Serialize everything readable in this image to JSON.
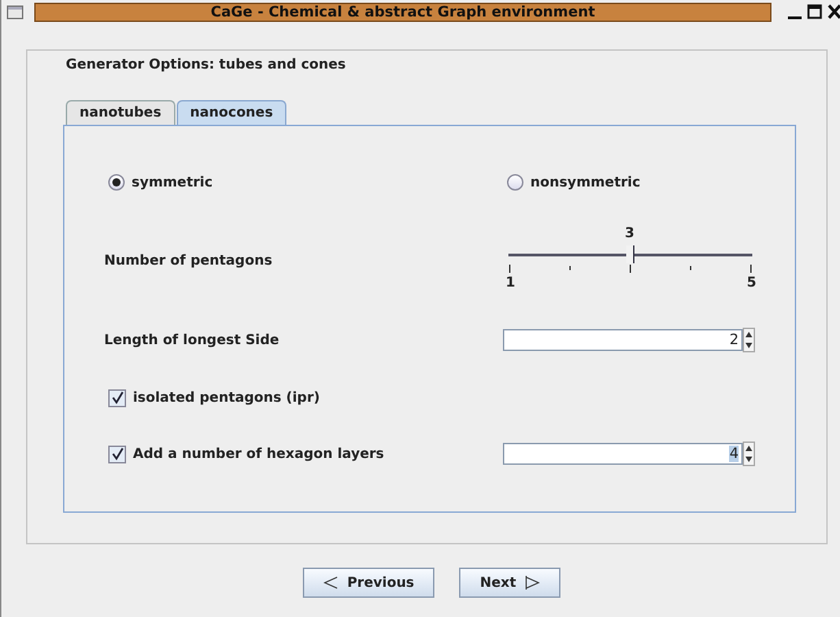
{
  "window": {
    "title": "CaGe - Chemical & abstract Graph environment"
  },
  "heading": "Generator Options:  tubes and cones",
  "tabs": [
    {
      "label": "nanotubes",
      "selected": false
    },
    {
      "label": "nanocones",
      "selected": true
    }
  ],
  "options": [
    {
      "kind": "radio_pair",
      "choices": [
        {
          "label": "symmetric",
          "selected": true
        },
        {
          "label": "nonsymmetric",
          "selected": false
        }
      ]
    },
    {
      "kind": "slider",
      "label": "Number of pentagons",
      "value": "3",
      "min_label": "1",
      "max_label": "5",
      "level": 0.5
    },
    {
      "kind": "spinner",
      "label": "Length of longest Side",
      "value": "2"
    },
    {
      "kind": "checkbox",
      "label": "isolated pentagons (ipr)",
      "checked": true
    },
    {
      "kind": "checkbox_spinner",
      "label": "Add a number of hexagon layers",
      "checked": true,
      "value": "4",
      "value_highlighted": true
    }
  ],
  "buttons": [
    {
      "label": "Previous",
      "kind": "back"
    },
    {
      "label": "Next",
      "kind": "forward"
    }
  ]
}
